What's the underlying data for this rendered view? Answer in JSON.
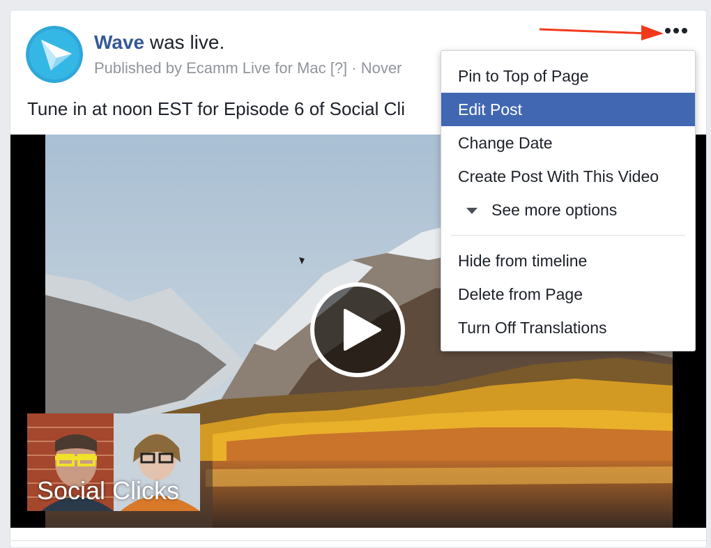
{
  "post": {
    "page_name": "Wave",
    "action_text": " was live.",
    "published_prefix": "Published by ",
    "publisher_app": "Ecamm Live for Mac",
    "help_marker": " [?]",
    "date_text": " · Nover",
    "text": "Tune in at noon EST for Episode 6 of Social Cli",
    "avatar_icon": "wave-logo-icon"
  },
  "video": {
    "overlay_title": "Social Clicks",
    "play_icon": "play-icon"
  },
  "menu": {
    "more_icon": "ellipsis-icon",
    "items": [
      {
        "label": "Pin to Top of Page"
      },
      {
        "label": "Edit Post",
        "highlighted": true
      },
      {
        "label": "Change Date"
      },
      {
        "label": "Create Post With This Video"
      },
      {
        "label": "See more options",
        "icon": "caret-down-icon"
      }
    ],
    "items_after_separator": [
      {
        "label": "Hide from timeline"
      },
      {
        "label": "Delete from Page"
      },
      {
        "label": "Turn Off Translations"
      }
    ]
  },
  "annotation": {
    "arrow_color": "#f2391b"
  },
  "colors": {
    "link_blue": "#365899",
    "highlight": "#4267b2",
    "muted_text": "#90949c"
  }
}
